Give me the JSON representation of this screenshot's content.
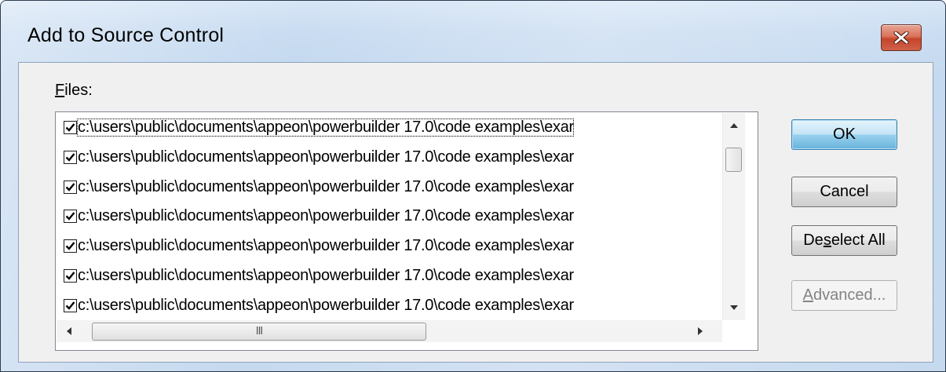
{
  "window": {
    "title": "Add to Source Control"
  },
  "icons": {
    "close": "close-icon",
    "checkbox_mark": "checkmark-icon",
    "scroll_up": "arrow-up-icon",
    "scroll_down": "arrow-down-icon",
    "scroll_left": "arrow-left-icon",
    "scroll_right": "arrow-right-icon",
    "thumb_grip": "grip-icon"
  },
  "files": {
    "label_mnemonic": "F",
    "label_rest": "iles:",
    "items": [
      {
        "checked": true,
        "path": "c:\\users\\public\\documents\\appeon\\powerbuilder 17.0\\code examples\\exar"
      },
      {
        "checked": true,
        "path": "c:\\users\\public\\documents\\appeon\\powerbuilder 17.0\\code examples\\exar"
      },
      {
        "checked": true,
        "path": "c:\\users\\public\\documents\\appeon\\powerbuilder 17.0\\code examples\\exar"
      },
      {
        "checked": true,
        "path": "c:\\users\\public\\documents\\appeon\\powerbuilder 17.0\\code examples\\exar"
      },
      {
        "checked": true,
        "path": "c:\\users\\public\\documents\\appeon\\powerbuilder 17.0\\code examples\\exar"
      },
      {
        "checked": true,
        "path": "c:\\users\\public\\documents\\appeon\\powerbuilder 17.0\\code examples\\exar"
      },
      {
        "checked": true,
        "path": "c:\\users\\public\\documents\\appeon\\powerbuilder 17.0\\code examples\\exar"
      }
    ],
    "hscroll_grip": "III"
  },
  "buttons": {
    "ok": "OK",
    "cancel": "Cancel",
    "deselect_pre": "De",
    "deselect_mnemonic": "s",
    "deselect_post": "elect All",
    "advanced_mnemonic": "A",
    "advanced_rest": "dvanced..."
  },
  "colors": {
    "default_button": "#98d1ef",
    "close_button": "#c4452a"
  }
}
